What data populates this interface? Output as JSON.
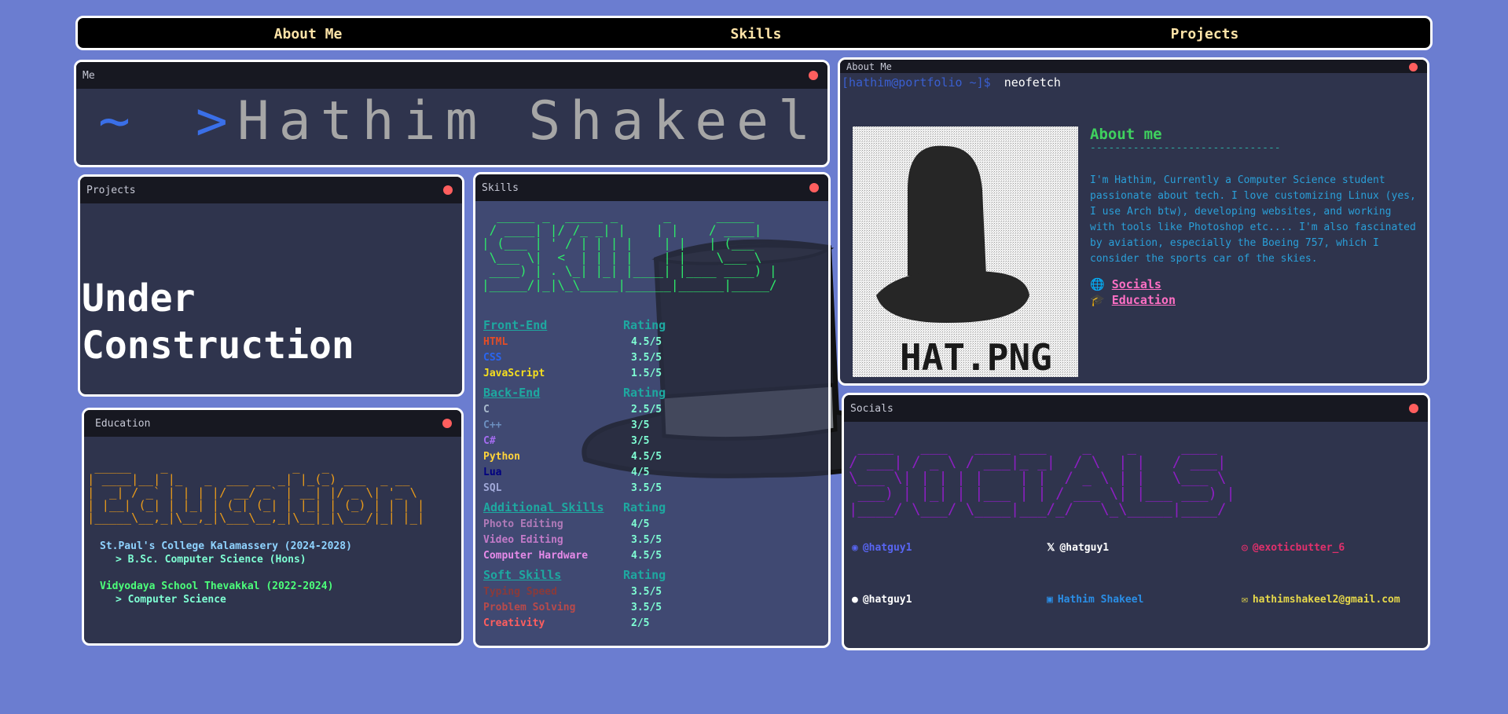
{
  "nav": {
    "about": "About Me",
    "skills": "Skills",
    "projects": "Projects"
  },
  "me": {
    "title": "Me",
    "tilde": "~",
    "prompt": ">",
    "name": "Hathim Shakeel"
  },
  "projects": {
    "title": "Projects",
    "line1": "Under",
    "line2": "Construction"
  },
  "skills": {
    "title": "Skills",
    "ascii": "  _____ _  _____ _      _      _____\n / ____| |/ /_ _| |    | |    / ____|\n| (___ | ' / | | | |    | |   | (___\n \\___ \\|  <  | | | |    | |    \\___ \\\n ____) | . \\_| |_| |____| |____ ____) |\n|_____/|_|\\_\\_____|______|______|_____/",
    "rating_label": "Rating",
    "sections": [
      {
        "name": "Front-End",
        "items": [
          {
            "name": "HTML",
            "rating": "4.5/5",
            "color": "#e34c26"
          },
          {
            "name": "CSS",
            "rating": "3.5/5",
            "color": "#2965f1"
          },
          {
            "name": "JavaScript",
            "rating": "1.5/5",
            "color": "#f7df1e"
          }
        ]
      },
      {
        "name": "Back-End",
        "items": [
          {
            "name": "C",
            "rating": "2.5/5",
            "color": "#a8b9cc"
          },
          {
            "name": "C++",
            "rating": "3/5",
            "color": "#6c8ebf"
          },
          {
            "name": "C#",
            "rating": "3/5",
            "color": "#a46cf0"
          },
          {
            "name": "Python",
            "rating": "4.5/5",
            "color": "#ffd43b"
          },
          {
            "name": "Lua",
            "rating": "4/5",
            "color": "#000080"
          },
          {
            "name": "SQL",
            "rating": "3.5/5",
            "color": "#a0a8d8"
          }
        ]
      },
      {
        "name": "Additional Skills",
        "items": [
          {
            "name": "Photo Editing",
            "rating": "4/5",
            "color": "#b07ab8"
          },
          {
            "name": "Video Editing",
            "rating": "3.5/5",
            "color": "#c27ac8"
          },
          {
            "name": "Computer Hardware",
            "rating": "4.5/5",
            "color": "#e58ae8"
          }
        ]
      },
      {
        "name": "Soft Skills",
        "items": [
          {
            "name": "Typing Speed",
            "rating": "3.5/5",
            "color": "#8a3a3a"
          },
          {
            "name": "Problem Solving",
            "rating": "3.5/5",
            "color": "#b84a4a"
          },
          {
            "name": "Creativity",
            "rating": "2/5",
            "color": "#ff5e5e"
          }
        ]
      }
    ]
  },
  "education": {
    "title": "Education",
    "ascii": " _____    _                 _   _\n| ____|__| |_   _  ___ __ _| |_(_) ___  _ __\n|  _| / _` | | | |/ __/ _` | __| |/ _ \\| '_ \\\n| |__| (_| | |_| | (_| (_| | |_| | (_) | | | |\n|_____\\__,_|\\__,_|\\___\\__,_|\\__|_|\\___/|_| |_|",
    "entries": [
      {
        "school": "St.Paul's College Kalamassery (2024-2028)",
        "course": "> B.Sc. Computer Science (Hons)",
        "school_color": "#8fd3ff",
        "course_color": "#7fffd4"
      },
      {
        "school": "Vidyodaya School Thevakkal (2022-2024)",
        "course": "> Computer Science",
        "school_color": "#4cff7a",
        "course_color": "#7fffd4"
      }
    ]
  },
  "about": {
    "title": "About Me",
    "prompt_user": "[hathim@portfolio ~]$",
    "command": "neofetch",
    "heading": "About me",
    "divider": "-------------------------------",
    "text": "I'm Hathim, Currently a Computer Science student passionate about tech. I love customizing Linux (yes, I use Arch btw), developing websites, and working with tools like Photoshop etc.... I'm also fascinated by aviation, especially the Boeing 757, which I consider the sports car of the skies.",
    "link_socials": "Socials",
    "link_education": "Education",
    "image_caption": "HAT.PNG"
  },
  "socials": {
    "title": "Socials",
    "ascii": " ____   ___   ____ ___    _    _     ____\n/ ___| / _ \\ / ___|_ _|  / \\  | |   / ___|\n\\___ \\| | | | |    | |  / _ \\ | |   \\___ \\\n ___) | |_| | |___ | | / ___ \\| |___ ___) |\n|____/ \\___/ \\____|___/_/   \\_\\_____|____/",
    "items": [
      {
        "icon": "discord-icon",
        "label": "@hatguy1",
        "color": "#5865f2"
      },
      {
        "icon": "x-icon",
        "label": "@hatguy1",
        "color": "#ffffff"
      },
      {
        "icon": "instagram-icon",
        "label": "@exoticbutter_6",
        "color": "#e1306c"
      },
      {
        "icon": "github-icon",
        "label": "@hatguy1",
        "color": "#ffffff"
      },
      {
        "icon": "linkedin-icon",
        "label": "Hathim Shakeel",
        "color": "#2a8ee6"
      },
      {
        "icon": "mail-icon",
        "label": "hathimshakeel2@gmail.com",
        "color": "#e6d84a"
      }
    ]
  }
}
